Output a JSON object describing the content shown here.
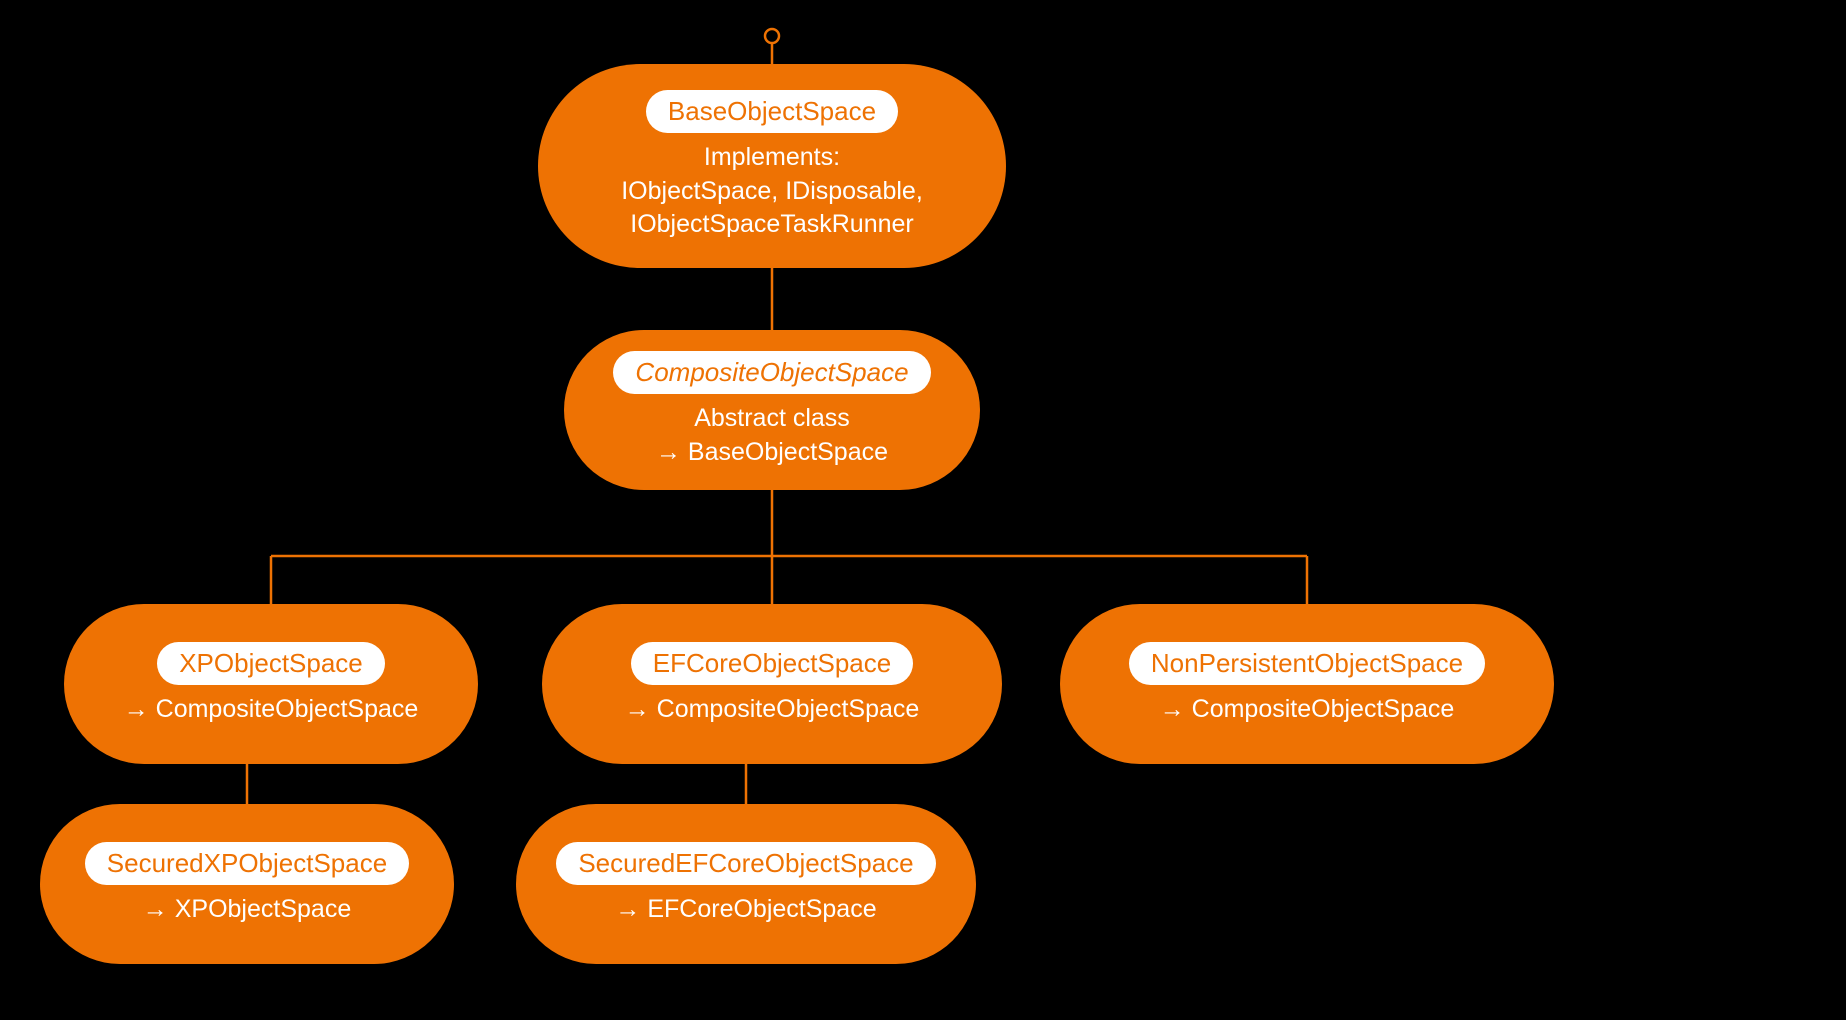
{
  "colors": {
    "accent": "#EE7203",
    "bg": "#000000",
    "text": "#FFFFFF"
  },
  "nodes": {
    "base": {
      "title": "BaseObjectSpace",
      "body": "Implements:\nIObjectSpace,  IDisposable,\nIObjectSpaceTaskRunner"
    },
    "composite": {
      "title": "CompositeObjectSpace",
      "body": "Abstract class\n→ BaseObjectSpace"
    },
    "xp": {
      "title": "XPObjectSpace",
      "body": "→ CompositeObjectSpace"
    },
    "ef": {
      "title": "EFCoreObjectSpace",
      "body": "→ CompositeObjectSpace"
    },
    "non": {
      "title": "NonPersistentObjectSpace",
      "body": "→ CompositeObjectSpace"
    },
    "sxp": {
      "title": "SecuredXPObjectSpace",
      "body": "→ XPObjectSpace"
    },
    "sef": {
      "title": "SecuredEFCoreObjectSpace",
      "body": "→ EFCoreObjectSpace"
    }
  }
}
